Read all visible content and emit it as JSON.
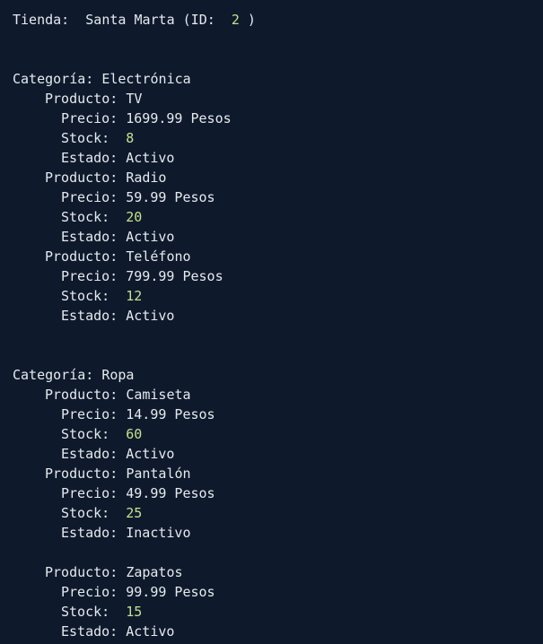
{
  "store": {
    "label": "Tienda:",
    "name": "Santa Marta",
    "id_open": "(ID:",
    "id": "2",
    "id_close": ")"
  },
  "labels": {
    "category": "Categoría:",
    "product": "Producto:",
    "price": "Precio:",
    "stock": "Stock:",
    "status": "Estado:"
  },
  "categories": [
    {
      "name": "Electrónica",
      "products": [
        {
          "name": "TV",
          "price": "1699.99 Pesos",
          "stock": "8",
          "status": "Activo"
        },
        {
          "name": "Radio",
          "price": "59.99 Pesos",
          "stock": "20",
          "status": "Activo"
        },
        {
          "name": "Teléfono",
          "price": "799.99 Pesos",
          "stock": "12",
          "status": "Activo"
        }
      ]
    },
    {
      "name": "Ropa",
      "products": [
        {
          "name": "Camiseta",
          "price": "14.99 Pesos",
          "stock": "60",
          "status": "Activo"
        },
        {
          "name": "Pantalón",
          "price": "49.99 Pesos",
          "stock": "25",
          "status": "Inactivo"
        },
        {
          "name": "Zapatos",
          "price": "99.99 Pesos",
          "stock": "15",
          "status": "Activo"
        }
      ]
    }
  ],
  "colors": {
    "background": "#0e1a2c",
    "text": "#e6e9ee",
    "number": "#c9e08c"
  }
}
